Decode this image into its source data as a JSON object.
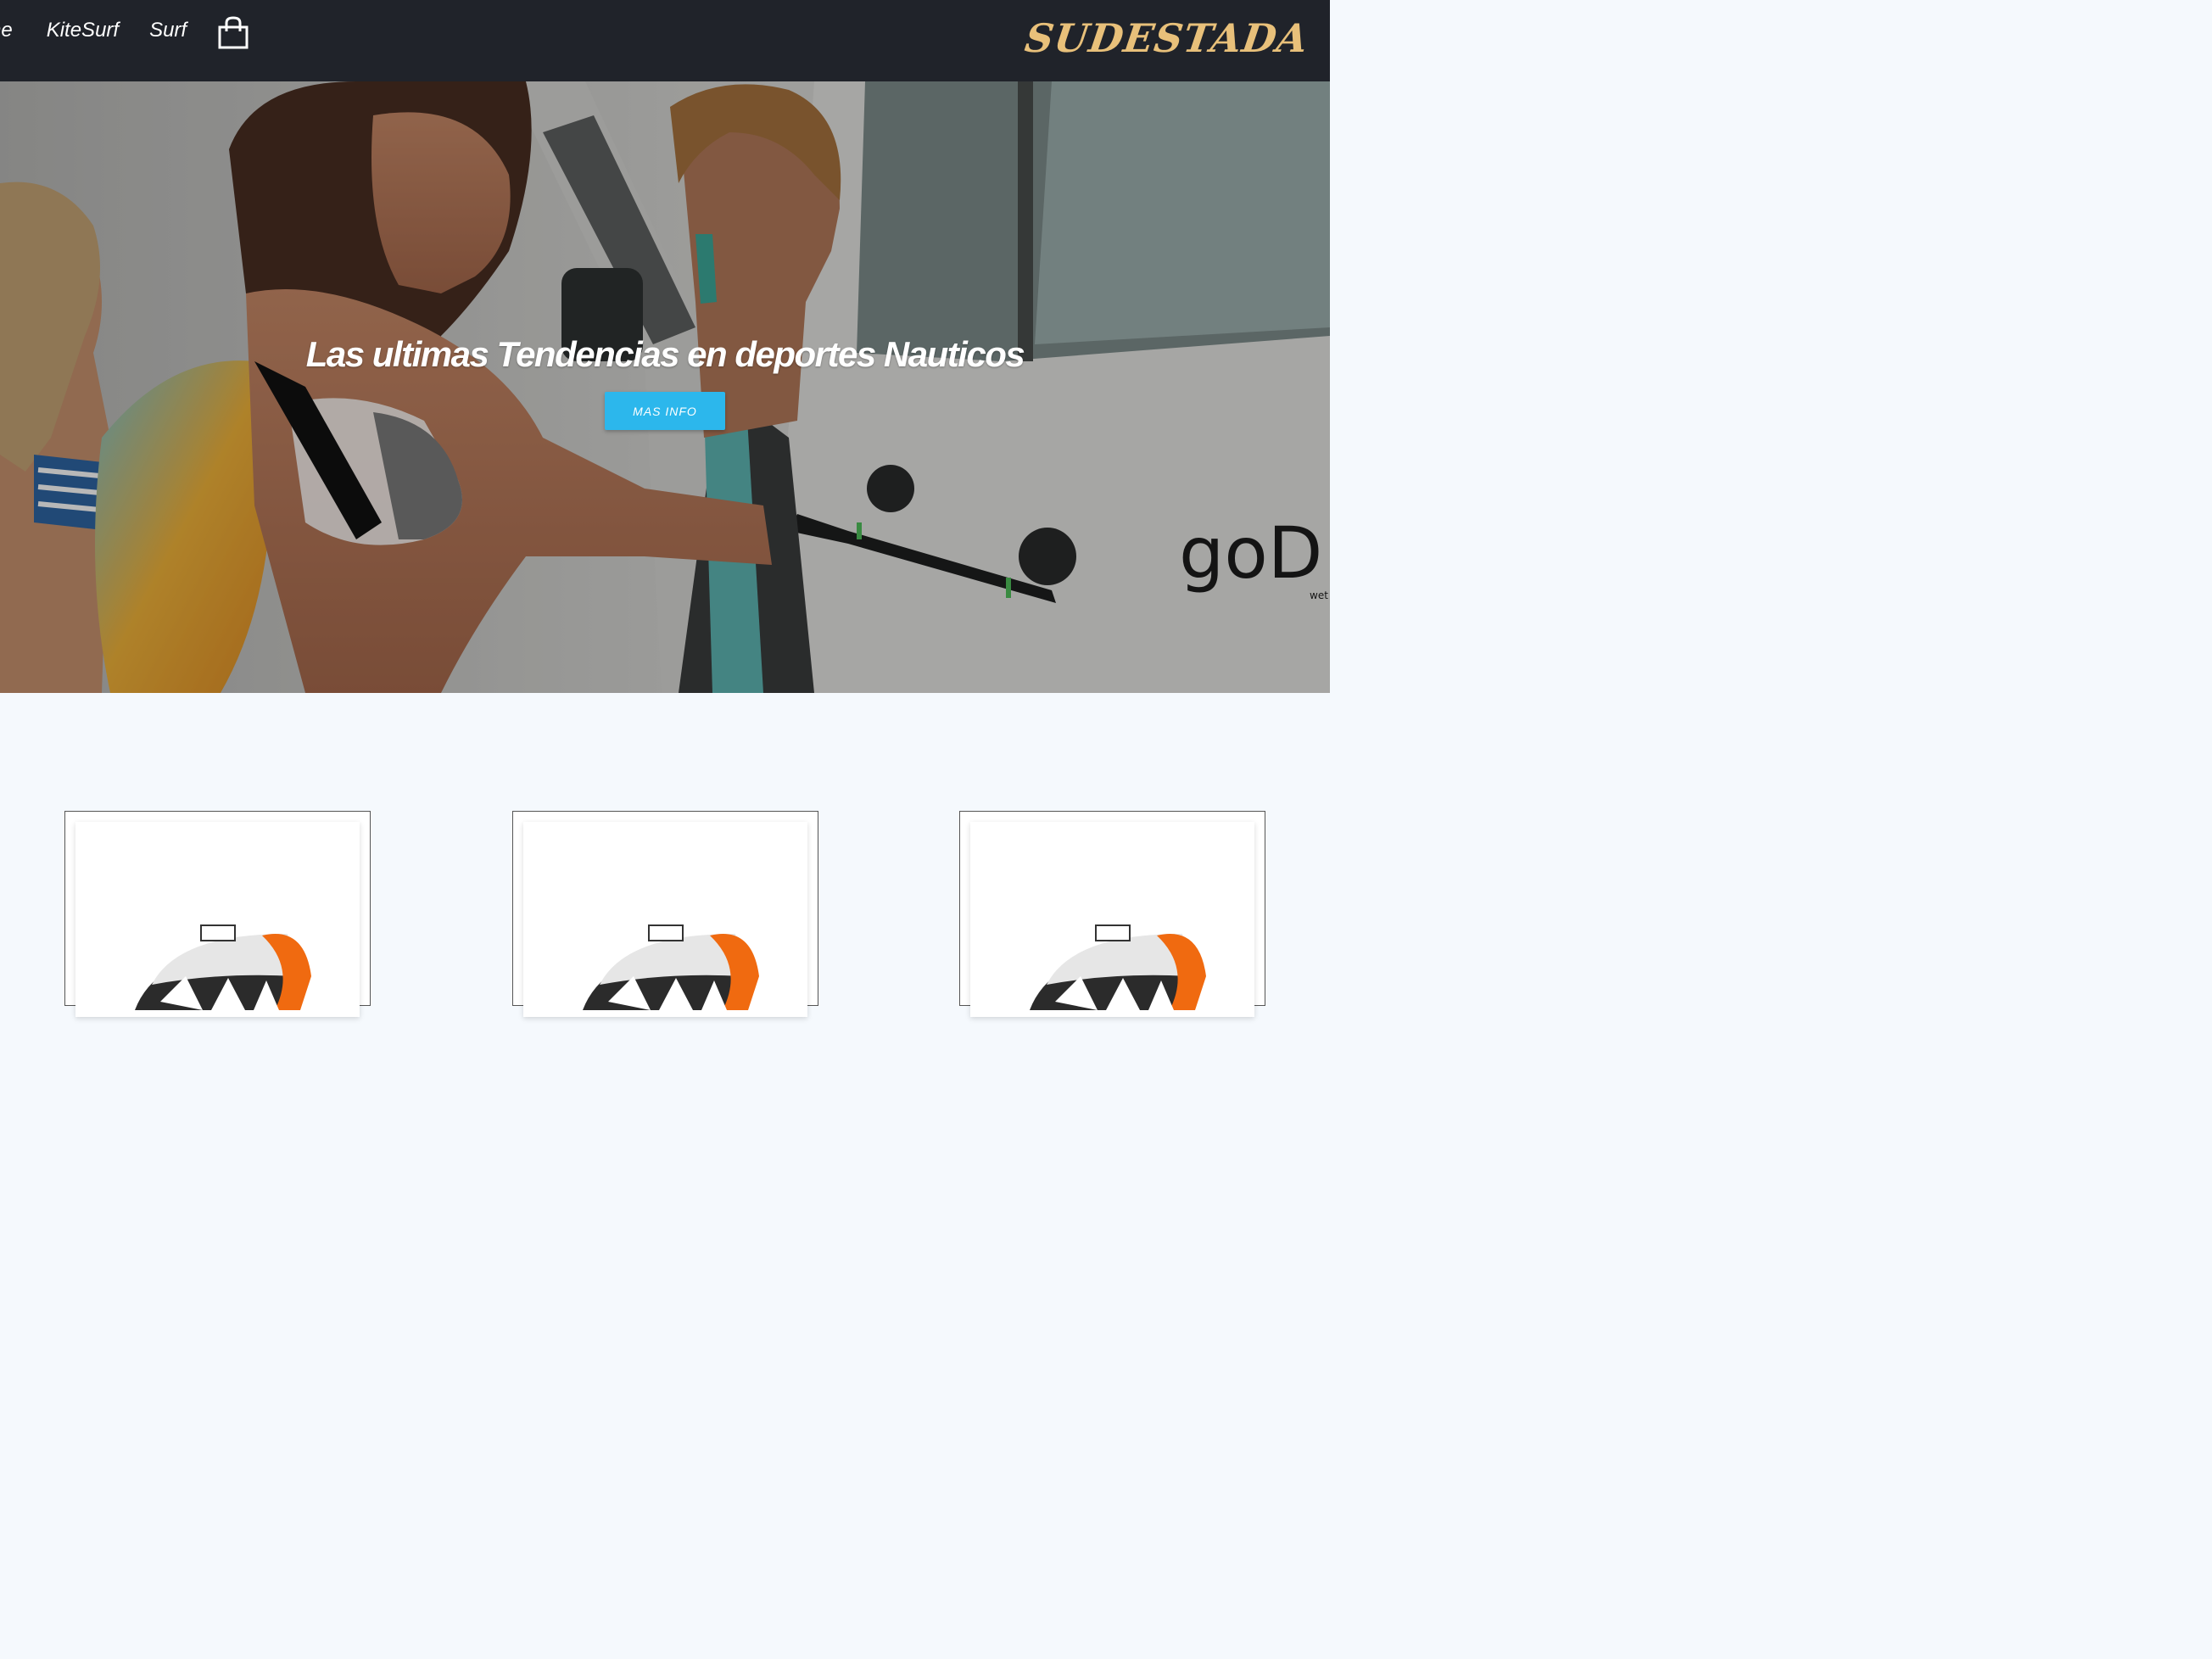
{
  "nav": {
    "links": [
      "Home",
      "KiteSurf",
      "Surf"
    ],
    "home_visible": "ne",
    "cart_icon": "shopping-bag-icon"
  },
  "brand": "SUDESTADA",
  "hero": {
    "title": "Las ultimas Tendencias en deportes Nauticos",
    "button_label": "MAS INFO",
    "van_logo": "goD",
    "van_logo_sub": "wet"
  },
  "products": {
    "items": [
      {
        "image": "kite-product-image"
      },
      {
        "image": "kite-product-image"
      },
      {
        "image": "kite-product-image"
      }
    ]
  },
  "colors": {
    "navbar": "#20232a",
    "brand": "#e8c07a",
    "button": "#2cb7ec",
    "page_bg": "#f5f9fd"
  }
}
